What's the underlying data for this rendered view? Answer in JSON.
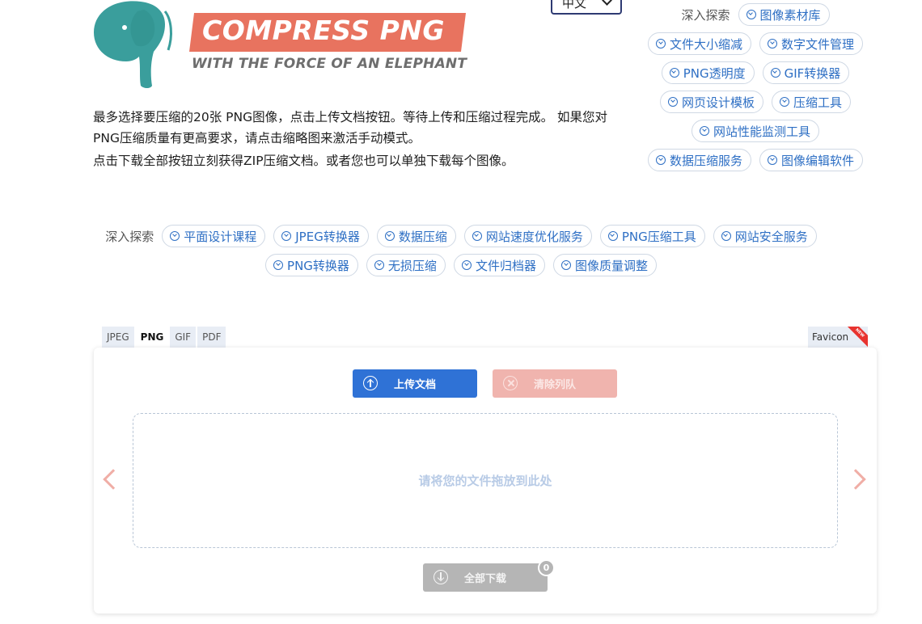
{
  "logo": {
    "title": "COMPRESS PNG",
    "tagline": "WITH THE FORCE OF AN ELEPHANT",
    "banner_color": "#e8735f",
    "mark_color": "#3a9e9c"
  },
  "language": {
    "selected": "中文"
  },
  "intro": {
    "p1": "最多选择要压缩的20张 PNG图像，点击上传文档按钮。等待上传和压缩过程完成。 如果您对PNG压缩质量有更高要求，请点击缩略图来激活手动模式。",
    "p2": "点击下载全部按钮立刻获得ZIP压缩文档。或者您也可以单独下载每个图像。"
  },
  "side_explore": {
    "label": "深入探索",
    "links": [
      "图像素材库",
      "文件大小缩减",
      "数字文件管理",
      "PNG透明度",
      "GIF转换器",
      "网页设计模板",
      "压缩工具",
      "网站性能监测工具",
      "数据压缩服务",
      "图像编辑软件"
    ]
  },
  "mid_explore": {
    "label": "深入探索",
    "links": [
      "平面设计课程",
      "JPEG转换器",
      "数据压缩",
      "网站速度优化服务",
      "PNG压缩工具",
      "网站安全服务",
      "PNG转换器",
      "无损压缩",
      "文件归档器",
      "图像质量调整"
    ]
  },
  "format_tabs": [
    "JPEG",
    "PNG",
    "GIF",
    "PDF"
  ],
  "active_format": "PNG",
  "favicon_tab": {
    "label": "Favicon",
    "ribbon": "NEW"
  },
  "toolbar": {
    "upload_label": "上传文档",
    "clear_label": "清除列队",
    "download_all_label": "全部下载",
    "queue_count": "0"
  },
  "dropzone": {
    "hint": "请将您的文件拖放到此处"
  },
  "colors": {
    "link": "#2e6fc4",
    "upload_button": "#2f72d6",
    "clear_button": "#f0b4ae",
    "download_button": "#b5b5b5",
    "arrow": "#f0aea6"
  }
}
